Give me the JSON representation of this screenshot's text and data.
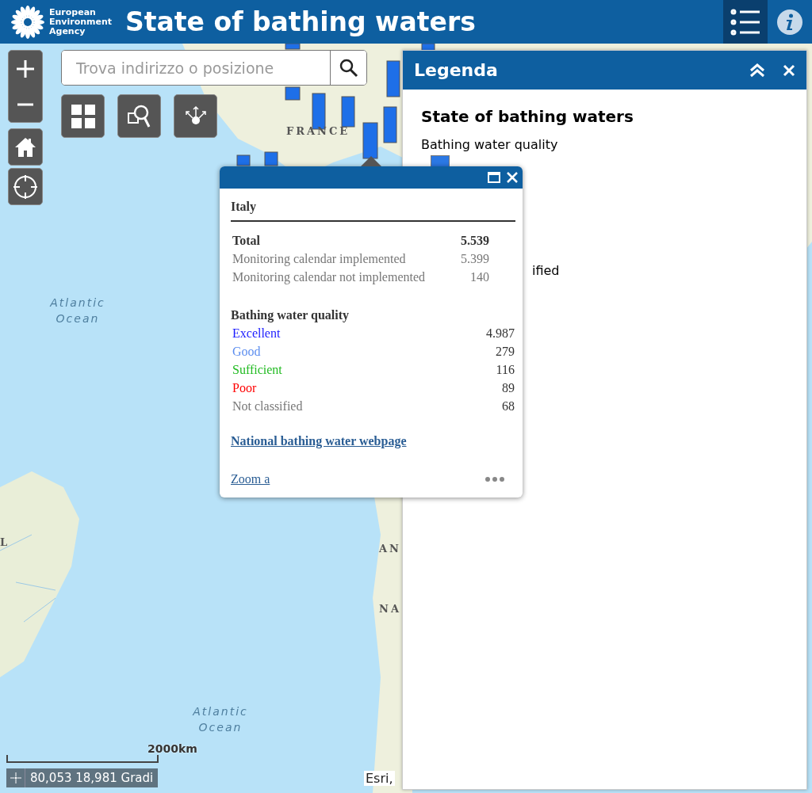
{
  "header": {
    "org_name": "European Environment Agency",
    "title": "State of bathing waters"
  },
  "map": {
    "search": {
      "placeholder": "Trova indirizzo o posizione"
    },
    "labels": [
      {
        "text": "FRANCE",
        "kind": "country"
      },
      {
        "text": "Atlantic Ocean",
        "kind": "ocean"
      },
      {
        "text": "Atlantic Ocean",
        "kind": "ocean"
      },
      {
        "text": "AN",
        "kind": "country"
      },
      {
        "text": "NA",
        "kind": "country"
      },
      {
        "text": "L",
        "kind": "country"
      }
    ],
    "scale": "2000km",
    "coordinates": "80,053 18,981 Gradi",
    "attribution": "Esri,"
  },
  "legend": {
    "title": "Legenda",
    "layer_title": "State of bathing waters",
    "group_title": "Bathing water quality",
    "items": [
      {
        "text": "ified"
      }
    ]
  },
  "popup": {
    "title": "Italy",
    "summary": [
      {
        "label": "Total",
        "value": "5.539",
        "kind": "total"
      },
      {
        "label": "Monitoring calendar implemented",
        "value": "5.399",
        "kind": "detail"
      },
      {
        "label": "Monitoring calendar not implemented",
        "value": "140",
        "kind": "detail"
      }
    ],
    "quality_title": "Bathing water quality",
    "quality": [
      {
        "label": "Excellent",
        "value": "4.987",
        "color": "#1a1aff"
      },
      {
        "label": "Good",
        "value": "279",
        "color": "#5b8def"
      },
      {
        "label": "Sufficient",
        "value": "116",
        "color": "#22bb22"
      },
      {
        "label": "Poor",
        "value": "89",
        "color": "#ff0000"
      },
      {
        "label": "Not classified",
        "value": "68",
        "color": "#777777"
      }
    ],
    "link": "National bathing water webpage",
    "zoom_link": "Zoom a"
  }
}
